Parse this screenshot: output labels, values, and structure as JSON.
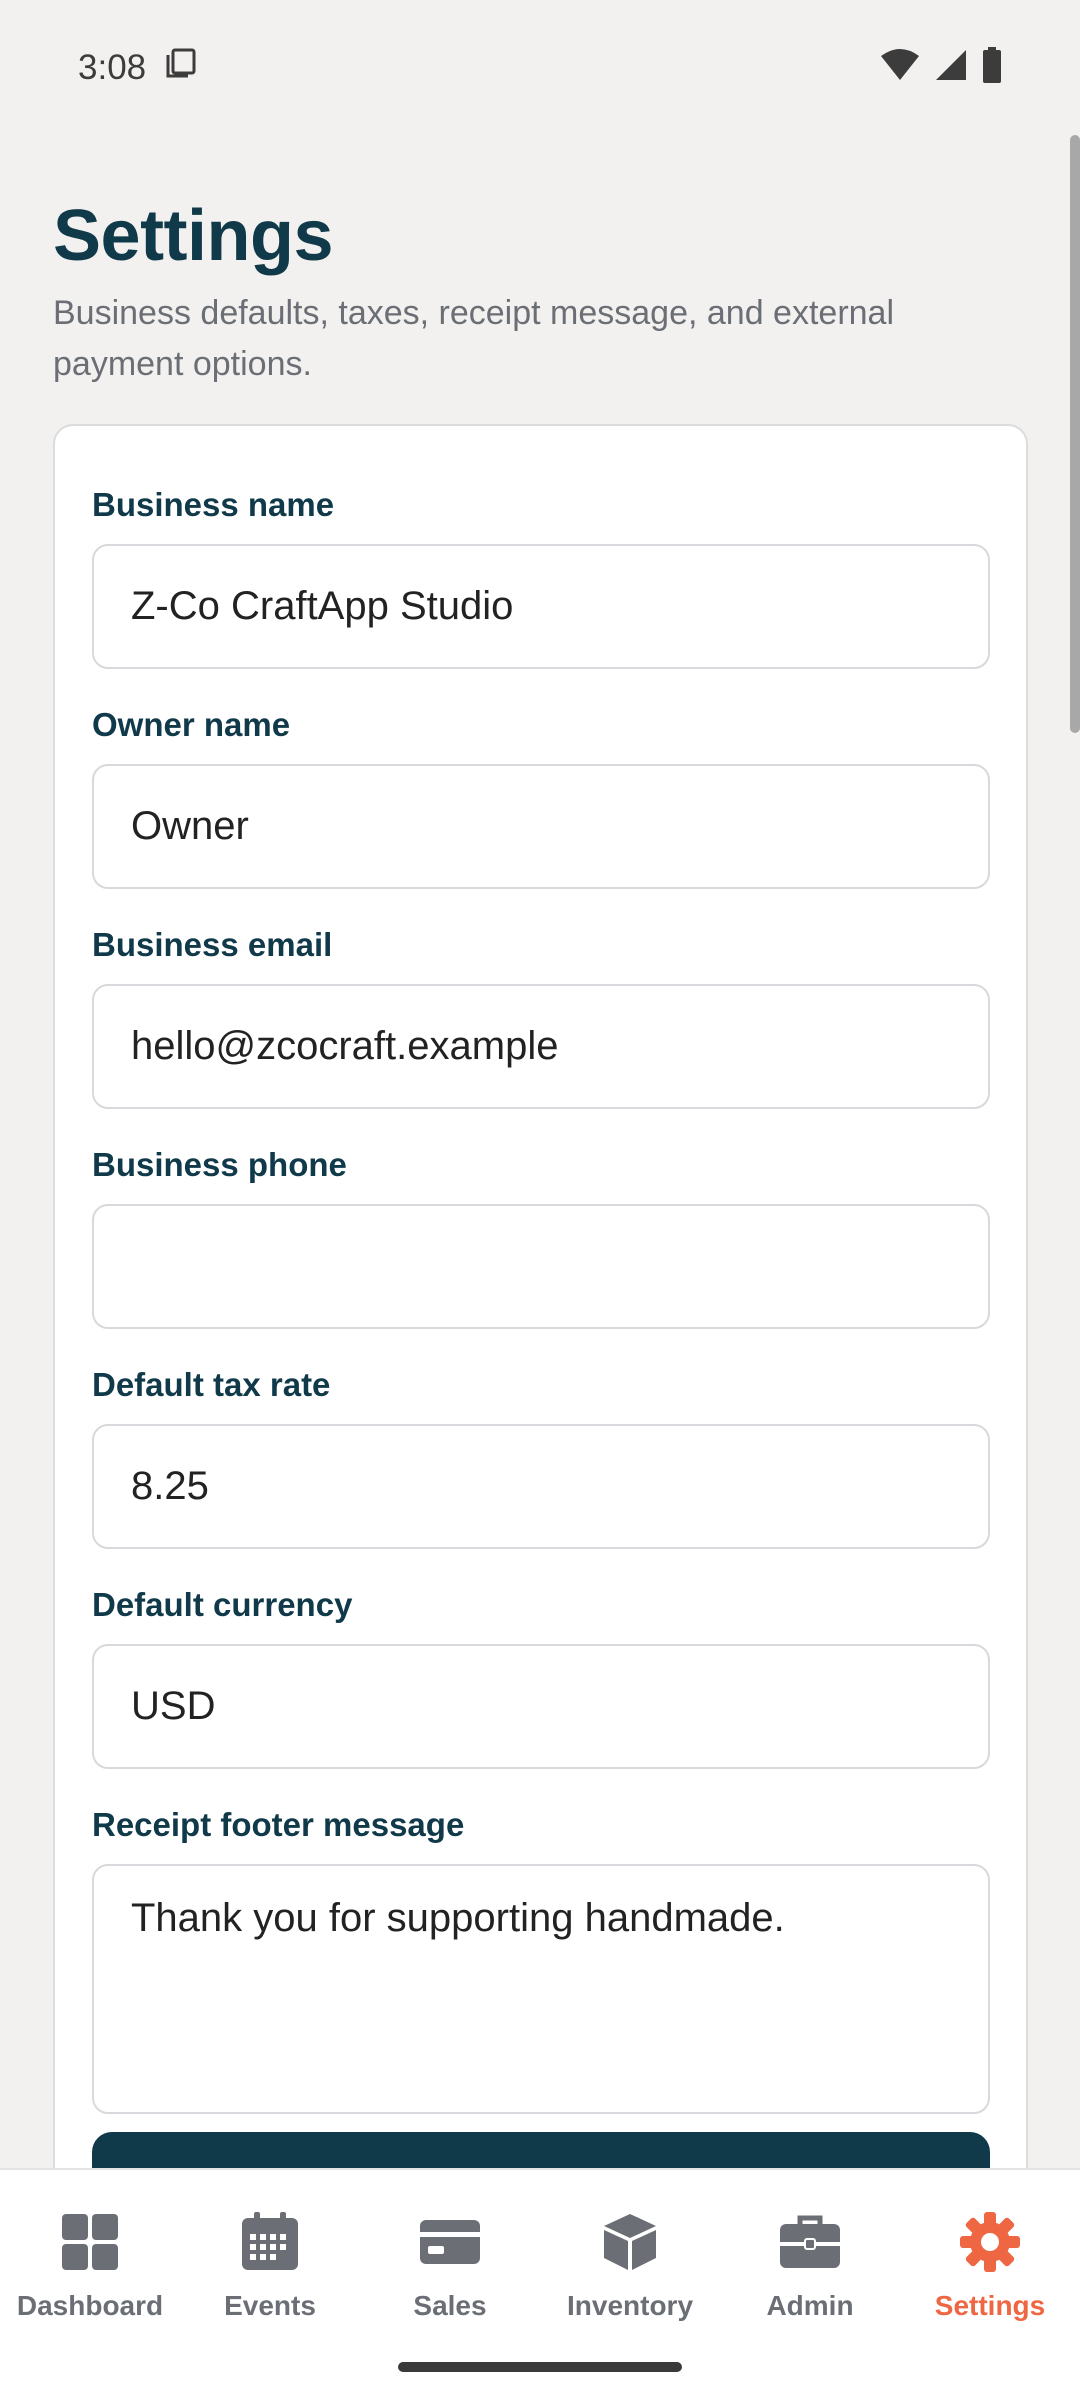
{
  "status_bar": {
    "time": "3:08"
  },
  "header": {
    "title": "Settings",
    "subtitle": "Business defaults, taxes, receipt message, and external payment options."
  },
  "form": {
    "business_name": {
      "label": "Business name",
      "value": "Z-Co CraftApp Studio"
    },
    "owner_name": {
      "label": "Owner name",
      "value": "Owner"
    },
    "business_email": {
      "label": "Business email",
      "value": "hello@zcocraft.example"
    },
    "business_phone": {
      "label": "Business phone",
      "value": ""
    },
    "default_tax_rate": {
      "label": "Default tax rate",
      "value": "8.25"
    },
    "default_currency": {
      "label": "Default currency",
      "value": "USD"
    },
    "receipt_footer": {
      "label": "Receipt footer message",
      "value": "Thank you for supporting handmade."
    }
  },
  "nav": {
    "items": [
      {
        "label": "Dashboard",
        "icon": "dashboard-icon",
        "active": false
      },
      {
        "label": "Events",
        "icon": "calendar-icon",
        "active": false
      },
      {
        "label": "Sales",
        "icon": "card-icon",
        "active": false
      },
      {
        "label": "Inventory",
        "icon": "box-icon",
        "active": false
      },
      {
        "label": "Admin",
        "icon": "briefcase-icon",
        "active": false
      },
      {
        "label": "Settings",
        "icon": "gear-icon",
        "active": true
      }
    ]
  },
  "colors": {
    "primary": "#10394a",
    "accent": "#ef6642",
    "muted": "#6b6f75",
    "background": "#f2f1ef"
  }
}
